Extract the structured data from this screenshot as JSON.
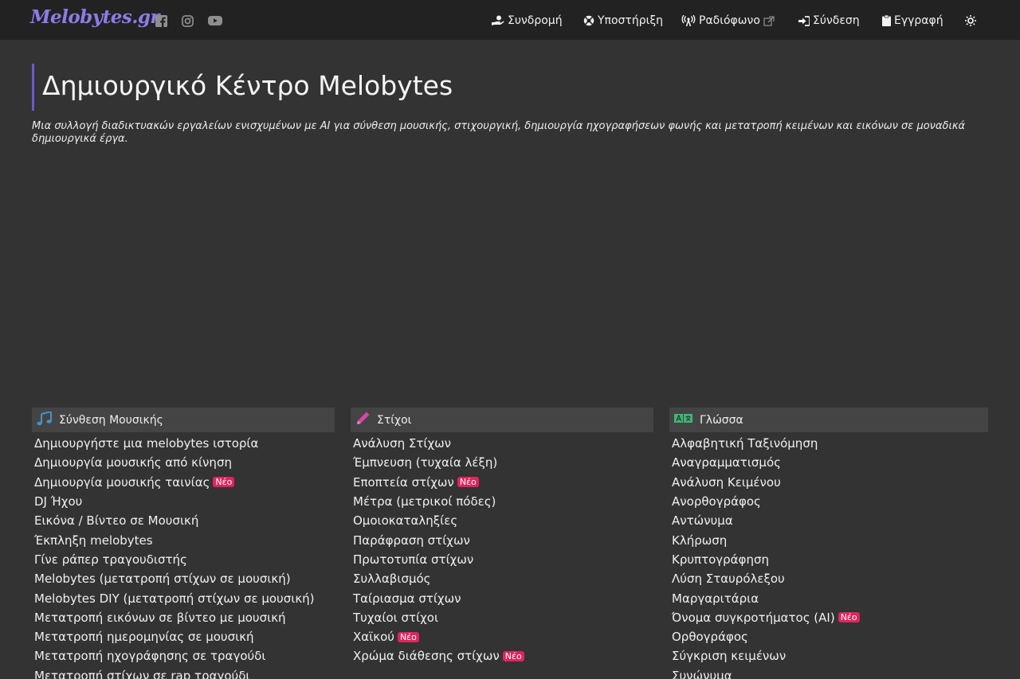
{
  "brand": "Melobytes.gr",
  "nav": [
    {
      "label": "Συνδρομή",
      "icon": "hand-coin-icon"
    },
    {
      "label": "Υποστήριξη",
      "icon": "lifebuoy-icon"
    },
    {
      "label": "Ραδιόφωνο",
      "icon": "broadcast-icon",
      "external": true
    },
    {
      "label": "Σύνδεση",
      "icon": "sign-in-icon"
    },
    {
      "label": "Εγγραφή",
      "icon": "clipboard-icon"
    }
  ],
  "theme_toggle_icon": "sun-icon",
  "social": [
    "facebook-icon",
    "instagram-icon",
    "youtube-icon"
  ],
  "page": {
    "title": "Δημιουργικό Κέντρο Melobytes",
    "description": "Μια συλλογή διαδικτυακών εργαλείων ενισχυμένων με AI για σύνθεση μουσικής, στιχουργική, δημιουργία ηχογραφήσεων φωνής και μετατροπή κειμένων και εικόνων σε μοναδικά δημιουργικά έργα."
  },
  "badge_new": "Νέο",
  "columns": [
    {
      "title": "Σύνθεση Μουσικής",
      "icon": "music-note-icon",
      "icon_color": "#4a90c8",
      "items": [
        {
          "label": "Δημιουργήστε μια melobytes ιστορία",
          "new": false
        },
        {
          "label": "Δημιουργία μουσικής από κίνηση",
          "new": false
        },
        {
          "label": "Δημιουργία μουσικής ταινίας",
          "new": true
        },
        {
          "label": "DJ Ήχου",
          "new": false
        },
        {
          "label": "Εικόνα / Βίντεο σε Μουσική",
          "new": false
        },
        {
          "label": "Έκπληξη melobytes",
          "new": false
        },
        {
          "label": "Γίνε ράπερ τραγουδιστής",
          "new": false
        },
        {
          "label": "Melobytes (μετατροπή στίχων σε μουσική)",
          "new": false
        },
        {
          "label": "Melobytes DIY (μετατροπή στίχων σε μουσική)",
          "new": false
        },
        {
          "label": "Μετατροπή εικόνων σε βίντεο με μουσική",
          "new": false
        },
        {
          "label": "Μετατροπή ημερομηνίας σε μουσική",
          "new": false
        },
        {
          "label": "Μετατροπή ηχογράφησης σε τραγούδι",
          "new": false
        },
        {
          "label": "Μετατροπή στίχων σε rap τραγούδι",
          "new": false
        }
      ]
    },
    {
      "title": "Στίχοι",
      "icon": "pencil-icon",
      "icon_color": "#d048a8",
      "items": [
        {
          "label": "Ανάλυση Στίχων",
          "new": false
        },
        {
          "label": "Έμπνευση (τυχαία λέξη)",
          "new": false
        },
        {
          "label": "Εποπτεία στίχων",
          "new": true
        },
        {
          "label": "Μέτρα (μετρικοί πόδες)",
          "new": false
        },
        {
          "label": "Ομοιοκαταληξίες",
          "new": false
        },
        {
          "label": "Παράφραση στίχων",
          "new": false
        },
        {
          "label": "Πρωτοτυπία στίχων",
          "new": false
        },
        {
          "label": "Συλλαβισμός",
          "new": false
        },
        {
          "label": "Ταίριασμα στίχων",
          "new": false
        },
        {
          "label": "Τυχαίοι στίχοι",
          "new": false
        },
        {
          "label": "Χαϊκού",
          "new": true
        },
        {
          "label": "Χρώμα διάθεσης στίχων",
          "new": true
        }
      ]
    },
    {
      "title": "Γλώσσα",
      "icon": "translate-icon",
      "icon_color": "#3cb878",
      "items": [
        {
          "label": "Αλφαβητική Ταξινόμηση",
          "new": false
        },
        {
          "label": "Αναγραμματισμός",
          "new": false
        },
        {
          "label": "Ανάλυση Κειμένου",
          "new": false
        },
        {
          "label": "Ανορθογράφος",
          "new": false
        },
        {
          "label": "Αντώνυμα",
          "new": false
        },
        {
          "label": "Κλήρωση",
          "new": false
        },
        {
          "label": "Κρυπτογράφηση",
          "new": false
        },
        {
          "label": "Λύση Σταυρόλεξου",
          "new": false
        },
        {
          "label": "Μαργαριτάρια",
          "new": false
        },
        {
          "label": "Όνομα συγκροτήματος (AI)",
          "new": true
        },
        {
          "label": "Ορθογράφος",
          "new": false
        },
        {
          "label": "Σύγκριση κειμένων",
          "new": false
        },
        {
          "label": "Συνώνυμα",
          "new": false
        }
      ]
    }
  ]
}
